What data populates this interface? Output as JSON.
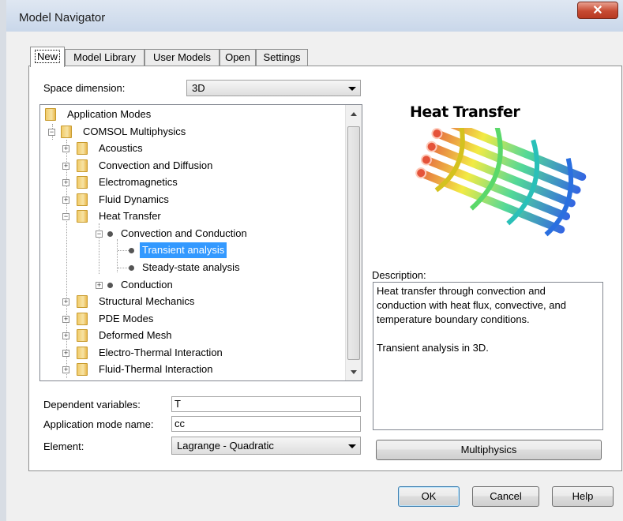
{
  "window": {
    "title": "Model Navigator",
    "close_glyph": "✕"
  },
  "tabs": [
    {
      "label": "New",
      "active": true
    },
    {
      "label": "Model Library"
    },
    {
      "label": "User Models"
    },
    {
      "label": "Open"
    },
    {
      "label": "Settings"
    }
  ],
  "space_dimension": {
    "label": "Space dimension:",
    "value": "3D"
  },
  "tree": {
    "root": "Application Modes",
    "comsol": "COMSOL Multiphysics",
    "categories": {
      "acoustics": "Acoustics",
      "convection_diffusion": "Convection and Diffusion",
      "electromagnetics": "Electromagnetics",
      "fluid_dynamics": "Fluid Dynamics",
      "heat_transfer": "Heat Transfer",
      "structural_mechanics": "Structural Mechanics",
      "pde_modes": "PDE Modes",
      "deformed_mesh": "Deformed Mesh",
      "electro_thermal": "Electro-Thermal Interaction",
      "fluid_thermal": "Fluid-Thermal Interaction"
    },
    "heat_children": {
      "convection_conduction": "Convection and Conduction",
      "transient": "Transient analysis",
      "steady_state": "Steady-state analysis",
      "conduction": "Conduction"
    },
    "selected": "Transient analysis"
  },
  "preview": {
    "title": "Heat Transfer"
  },
  "description": {
    "label": "Description:",
    "line1": "Heat transfer through convection and",
    "line2": "conduction with heat flux, convective, and",
    "line3": "temperature boundary conditions.",
    "line4": "Transient analysis in 3D."
  },
  "fields": {
    "dependent_variables": {
      "label": "Dependent variables:",
      "value": "T"
    },
    "application_mode_name": {
      "label": "Application mode name:",
      "value": "cc"
    },
    "element": {
      "label": "Element:",
      "value": "Lagrange - Quadratic"
    }
  },
  "buttons": {
    "multiphysics": "Multiphysics",
    "ok": "OK",
    "cancel": "Cancel",
    "help": "Help"
  },
  "colors": {
    "selection": "#3399ff",
    "titlebar": "#c9d7ea",
    "close": "#c74a32"
  }
}
